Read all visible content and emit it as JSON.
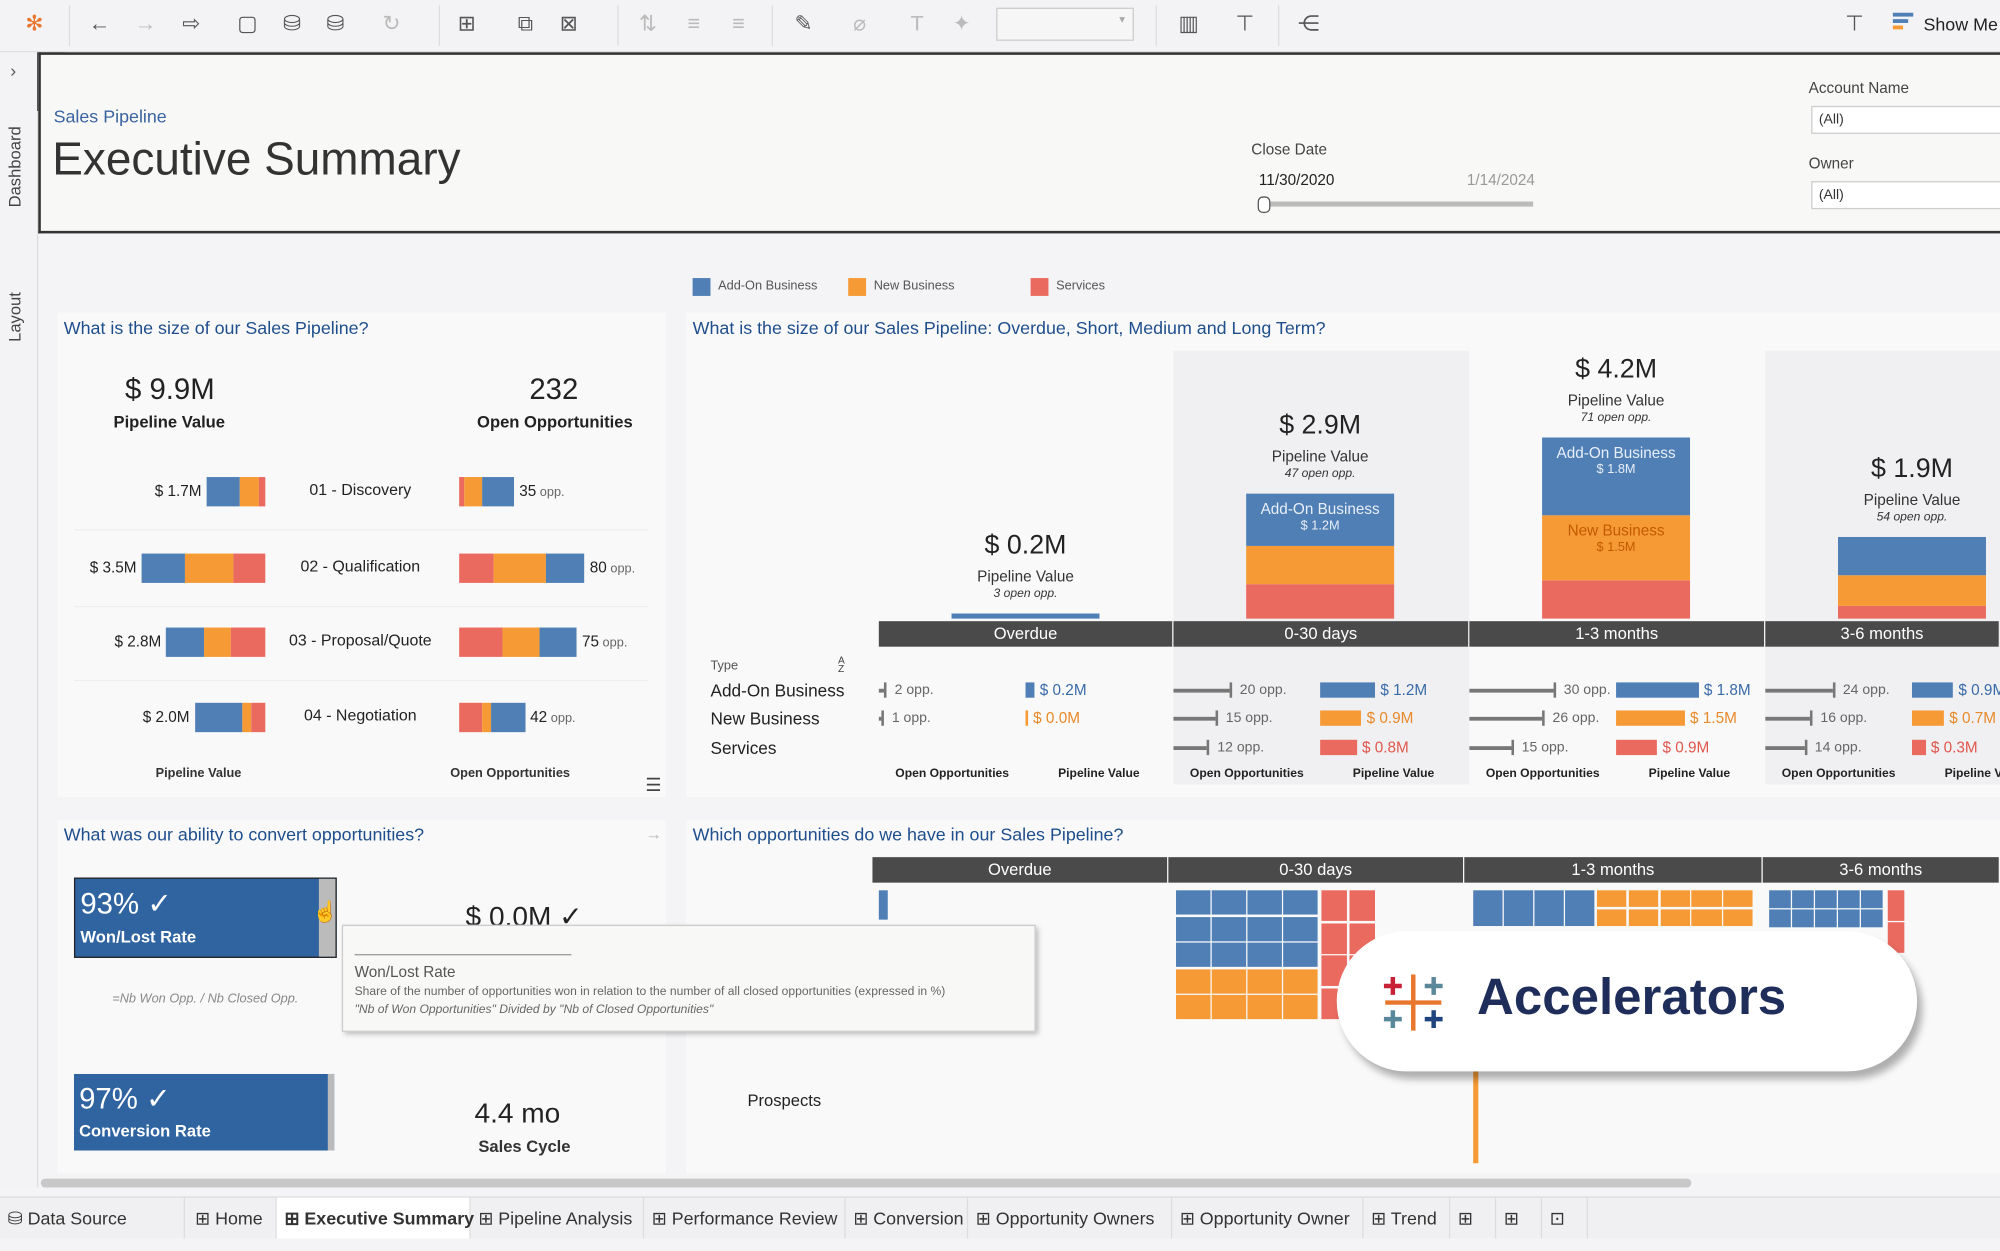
{
  "colors": {
    "add_on": "#4f7fb5",
    "new": "#f59a35",
    "services": "#ea6a5f",
    "title": "#1f4e8c",
    "dark": "#4a4a4a"
  },
  "toolbar": {
    "show_me": "Show Me",
    "icons": [
      "tableau-logo-icon",
      "back-icon",
      "forward-icon",
      "redo-icon",
      "save-icon",
      "new-datasource-icon",
      "pause-icon",
      "refresh-icon",
      "new-worksheet-icon",
      "duplicate-icon",
      "clear-icon",
      "swap-icon",
      "sort-asc-icon",
      "sort-desc-icon",
      "highlight-icon",
      "annotate-icon",
      "label-icon",
      "pin-icon",
      "fit-dropdown",
      "chart-icon",
      "presentation-icon",
      "share-icon"
    ]
  },
  "sidebar": {
    "dashboard": "Dashboard",
    "layout": "Layout"
  },
  "header": {
    "breadcrumb": "Sales Pipeline",
    "title": "Executive Summary"
  },
  "filters": {
    "close_date": {
      "label": "Close Date",
      "start": "11/30/2020",
      "end": "1/14/2024"
    },
    "account_name": {
      "label": "Account Name",
      "value": "(All)"
    },
    "owner": {
      "label": "Owner",
      "value": "(All)"
    }
  },
  "legend": [
    "Add-On Business",
    "New Business",
    "Services"
  ],
  "panel1": {
    "title": "What is the size of our Sales Pipeline?",
    "pipeline_value": "$ 9.9M",
    "pipeline_value_label": "Pipeline Value",
    "open_opps": "232",
    "open_opps_label": "Open Opportunities",
    "axis_left": "Pipeline Value",
    "axis_right": "Open Opportunities",
    "stages": [
      {
        "name": "01 - Discovery",
        "value_label": "$ 1.7M",
        "value": [
          0.94,
          0.54,
          0.18
        ],
        "opp_label": "35",
        "opps": [
          20,
          12,
          3
        ]
      },
      {
        "name": "02 - Qualification",
        "value_label": "$ 3.5M",
        "value": [
          1.23,
          1.37,
          0.9
        ],
        "opp_label": "80",
        "opps": [
          25,
          33,
          22
        ]
      },
      {
        "name": "03 - Proposal/Quote",
        "value_label": "$ 2.8M",
        "value": [
          1.05,
          0.76,
          0.99
        ],
        "opp_label": "75",
        "opps": [
          24,
          23,
          28
        ]
      },
      {
        "name": "04 - Negotiation",
        "value_label": "$ 2.0M",
        "value": [
          1.34,
          0.25,
          0.41
        ],
        "opp_label": "42",
        "opps": [
          22,
          5,
          15
        ]
      }
    ],
    "opp_suffix": "opp."
  },
  "panel2": {
    "title": "What is the size of our Sales Pipeline: Overdue, Short, Medium and Long Term?",
    "type_label": "Type",
    "types": [
      "Add-On Business",
      "New Business",
      "Services"
    ],
    "col_labels": [
      "Open Opportunities",
      "Pipeline Value"
    ],
    "pipeline_value_label": "Pipeline Value",
    "groups": [
      {
        "name": "Overdue",
        "total": "$ 0.2M",
        "opps_text": "3 open opp.",
        "values": [
          0.12,
          0,
          0
        ],
        "segment_labels": [
          "",
          ""
        ],
        "rows": [
          {
            "opps": 2,
            "opp_label": "2 opp.",
            "value": 0.2,
            "value_label": "$ 0.2M"
          },
          {
            "opps": 1,
            "opp_label": "1 opp.",
            "value": 0.0,
            "value_label": "$ 0.0M"
          },
          null
        ]
      },
      {
        "name": "0-30 days",
        "total": "$ 2.9M",
        "opps_text": "47 open opp.",
        "values": [
          1.2,
          0.9,
          0.8
        ],
        "segment_labels": [
          "Add-On Business|$ 1.2M",
          ""
        ],
        "rows": [
          {
            "opps": 20,
            "opp_label": "20 opp.",
            "value": 1.2,
            "value_label": "$ 1.2M"
          },
          {
            "opps": 15,
            "opp_label": "15 opp.",
            "value": 0.9,
            "value_label": "$ 0.9M"
          },
          {
            "opps": 12,
            "opp_label": "12 opp.",
            "value": 0.8,
            "value_label": "$ 0.8M"
          }
        ]
      },
      {
        "name": "1-3 months",
        "total": "$ 4.2M",
        "opps_text": "71 open opp.",
        "values": [
          1.8,
          1.5,
          0.9
        ],
        "segment_labels": [
          "Add-On Business|$ 1.8M",
          "New Business|$ 1.5M"
        ],
        "rows": [
          {
            "opps": 30,
            "opp_label": "30 opp.",
            "value": 1.8,
            "value_label": "$ 1.8M"
          },
          {
            "opps": 26,
            "opp_label": "26 opp.",
            "value": 1.5,
            "value_label": "$ 1.5M"
          },
          {
            "opps": 15,
            "opp_label": "15 opp.",
            "value": 0.9,
            "value_label": "$ 0.9M"
          }
        ]
      },
      {
        "name": "3-6 months",
        "total": "$ 1.9M",
        "opps_text": "54 open opp.",
        "values": [
          0.9,
          0.7,
          0.3
        ],
        "segment_labels": [
          "",
          ""
        ],
        "rows": [
          {
            "opps": 24,
            "opp_label": "24 opp.",
            "value": 0.9,
            "value_label": "$ 0.9M"
          },
          {
            "opps": 16,
            "opp_label": "16 opp.",
            "value": 0.7,
            "value_label": "$ 0.7M"
          },
          {
            "opps": 14,
            "opp_label": "14 opp.",
            "value": 0.3,
            "value_label": "$ 0.3M"
          }
        ]
      }
    ]
  },
  "panel3": {
    "title": "What was our ability to convert opportunities?",
    "won_lost": {
      "value": "93% ✓",
      "label": "Won/Lost Rate"
    },
    "won_value": "$ 0.0M ✓",
    "formula": "=Nb Won Opp. / Nb Closed Opp.",
    "conversion": {
      "value": "97% ✓",
      "label": "Conversion Rate"
    },
    "sales_cycle": {
      "value": "4.4 mo",
      "label": "Sales Cycle"
    }
  },
  "tooltip": {
    "title": "Won/Lost Rate",
    "desc": "Share of the number of opportunities won in relation to the number of all closed opportunities (expressed in %)",
    "formula": "\"Nb of Won Opportunities\" Divided by \"Nb of Closed Opportunities\""
  },
  "panel4": {
    "title": "Which opportunities do we have in our Sales Pipeline?",
    "groups": [
      "Overdue",
      "0-30 days",
      "1-3 months",
      "3-6 months"
    ],
    "row_label": "Prospects"
  },
  "badge": {
    "text": "Accelerators"
  },
  "tabs": {
    "data_source": "Data Source",
    "sheets": [
      "Home",
      "Executive Summary",
      "Pipeline Analysis",
      "Performance Review",
      "Conversion",
      "Opportunity Owners",
      "Opportunity Owner",
      "Trend"
    ],
    "active": "Executive Summary"
  }
}
